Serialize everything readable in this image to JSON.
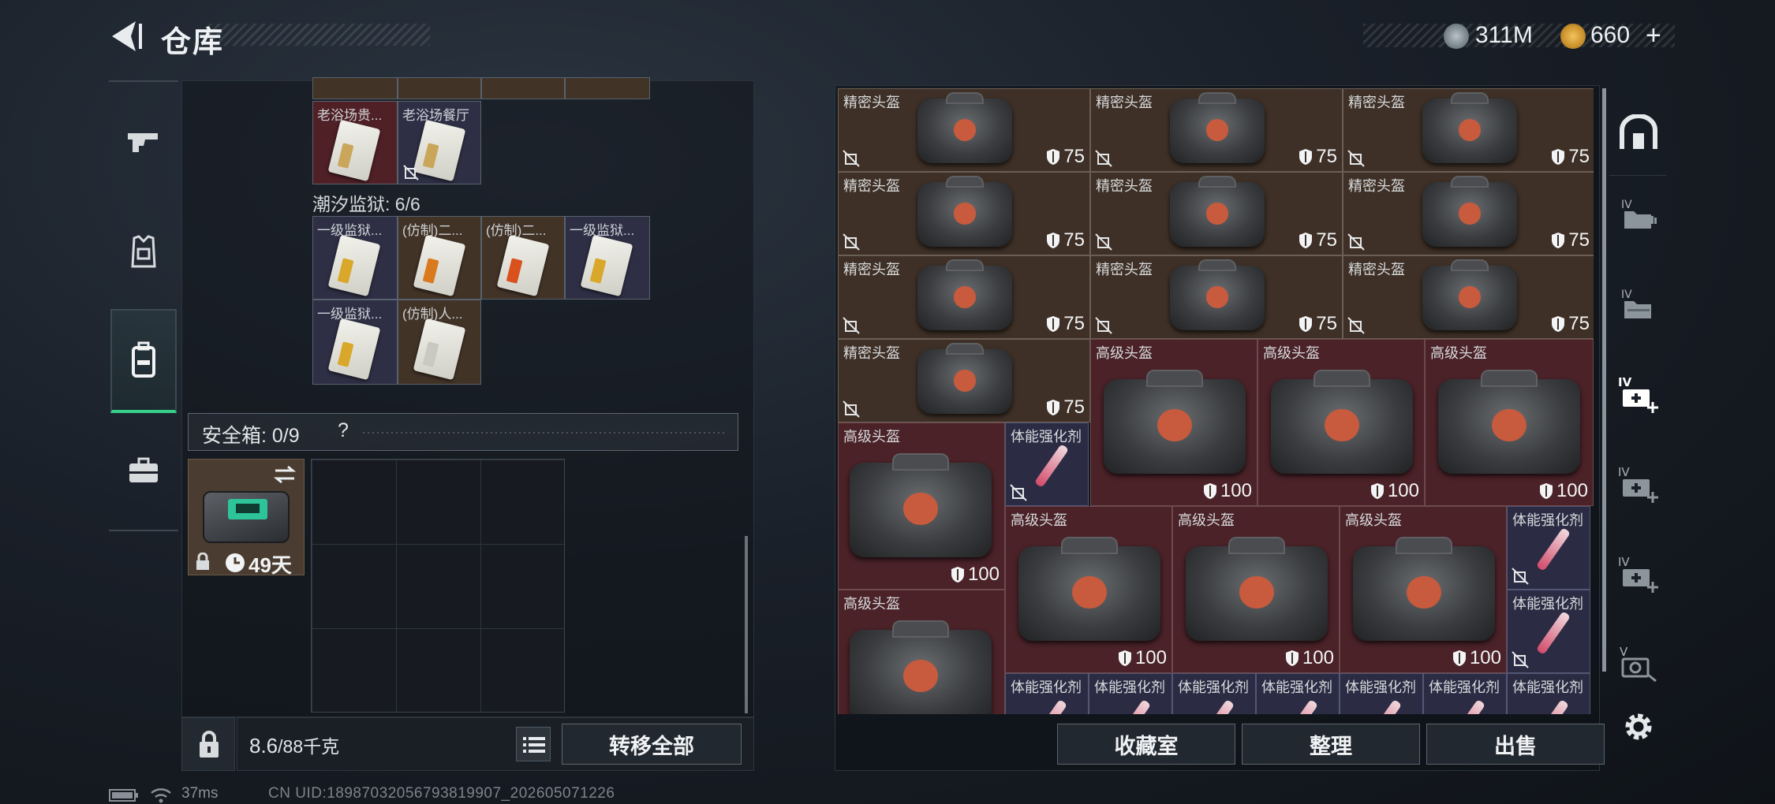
{
  "header": {
    "title": "仓库",
    "currency_1": "311M",
    "currency_2": "660",
    "currency_2_plus": "+"
  },
  "left": {
    "partial_row_labels": [
      "老浴场贵...",
      "老浴场餐厅"
    ],
    "section": "潮汐监狱: 6/6",
    "prison_items": [
      "一级监狱...",
      "(仿制)二...",
      "(仿制)二...",
      "一级监狱...",
      "一级监狱...",
      "(仿制)人..."
    ],
    "safe_title": "安全箱: 0/9",
    "safe_help": "?",
    "safe_days": "49天",
    "weight_value": "8.6",
    "weight_unit": "/88千克",
    "transfer_all": "转移全部"
  },
  "right": {
    "precision_helmet": "精密头盔",
    "advanced_helmet": "高级头盔",
    "stamina": "体能强化剂",
    "dur_75": "75",
    "dur_100": "100",
    "btn_collection": "收藏室",
    "btn_sort": "整理",
    "btn_sell": "出售"
  },
  "status": {
    "ping": "37ms",
    "uid": "CN UID:18987032056793819907_202605071226"
  },
  "colors": {
    "accent_green": "#35d08a",
    "item_red": "#4a2228",
    "item_brown": "#3e3026",
    "item_purple": "#2b2c44"
  }
}
